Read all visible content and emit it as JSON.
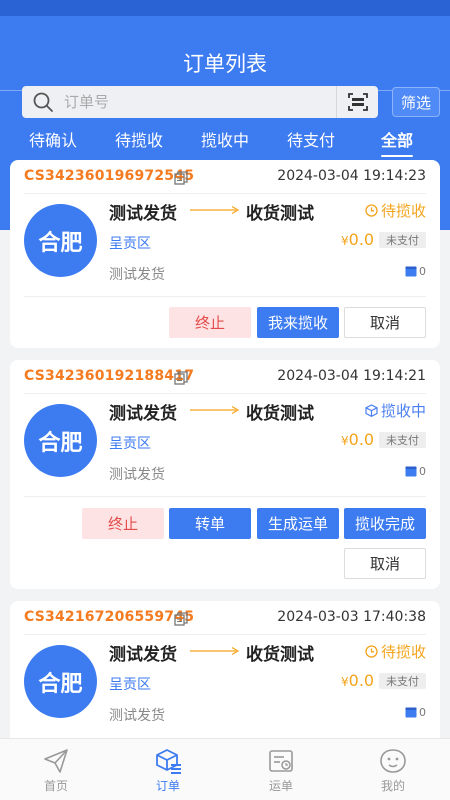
{
  "header": {
    "title": "订单列表"
  },
  "search": {
    "placeholder": "订单号",
    "filter_label": "筛选"
  },
  "tabs": [
    {
      "label": "待确认",
      "active": false
    },
    {
      "label": "待揽收",
      "active": false
    },
    {
      "label": "揽收中",
      "active": false
    },
    {
      "label": "待支付",
      "active": false
    },
    {
      "label": "全部",
      "active": true
    }
  ],
  "orders": [
    {
      "order_no": "CS342360196972545",
      "time": "2024-03-04 19:14:23",
      "city": "合肥",
      "sender": "测试发货",
      "receiver": "收货测试",
      "status": "待揽收",
      "district": "呈贡区",
      "price_symbol": "¥",
      "price": "0.0",
      "pay_status": "未支付",
      "note": "测试发货",
      "count": "0",
      "buttons": [
        "终止",
        "我来揽收",
        "取消"
      ]
    },
    {
      "order_no": "CS342360192188417",
      "time": "2024-03-04 19:14:21",
      "city": "合肥",
      "sender": "测试发货",
      "receiver": "收货测试",
      "status": "揽收中",
      "district": "呈贡区",
      "price_symbol": "¥",
      "price": "0.0",
      "pay_status": "未支付",
      "note": "测试发货",
      "count": "0",
      "buttons": [
        "终止",
        "转单",
        "生成运单",
        "揽收完成",
        "取消"
      ]
    },
    {
      "order_no": "CS342167206559745",
      "time": "2024-03-03 17:40:38",
      "city": "合肥",
      "sender": "测试发货",
      "receiver": "收货测试",
      "status": "待揽收",
      "district": "呈贡区",
      "price_symbol": "¥",
      "price": "0.0",
      "pay_status": "未支付",
      "note": "测试发货",
      "count": "0"
    }
  ],
  "nav": [
    {
      "label": "首页",
      "icon": "paper-plane-icon",
      "active": false
    },
    {
      "label": "订单",
      "icon": "order-box-icon",
      "active": true
    },
    {
      "label": "运单",
      "icon": "waybill-icon",
      "active": false
    },
    {
      "label": "我的",
      "icon": "profile-face-icon",
      "active": false
    }
  ],
  "colors": {
    "primary": "#3d7bf1",
    "order_no": "#f47b20",
    "status_pending": "#f3a41c",
    "status_collecting": "#4a7ff0",
    "danger": "#e44b4b"
  }
}
